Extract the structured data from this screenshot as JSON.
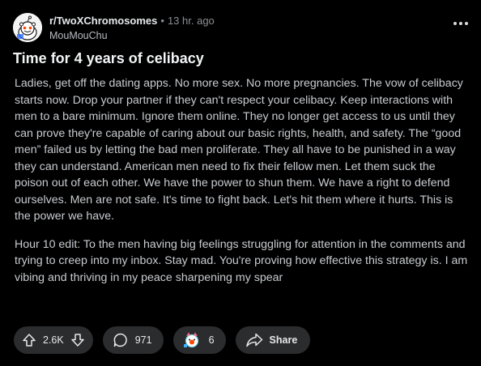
{
  "post": {
    "subreddit": "r/TwoXChromosomes",
    "separator": "•",
    "time": "13 hr. ago",
    "author": "MouMouChu",
    "title": "Time for 4 years of celibacy",
    "paragraphs": [
      "Ladies, get off the dating apps. No more sex. No more pregnancies. The vow of celibacy starts now. Drop your partner if they can't respect your celibacy. Keep interactions with men to a bare minimum. Ignore them online. They no longer get access to us until they can prove they're capable of caring about our basic rights, health, and safety. The “good men” failed us by letting the bad men proliferate. They all have to be punished in a way they can understand. American men need to fix their fellow men. Let them suck the poison out of each other. We have the power to shun them. We have a right to defend ourselves. Men are not safe. It's time to fight back. Let's hit them where it hurts. This is the power we have.",
      "Hour 10 edit: To the men having big feelings struggling for attention in the comments and trying to creep into my inbox. Stay mad. You're proving how effective this strategy is. I am vibing and thriving in my peace sharpening my spear"
    ]
  },
  "actions": {
    "votes": "2.6K",
    "comments": "971",
    "awards": "6",
    "share_label": "Share"
  },
  "icons": {
    "avatar": "reddit-snoo-avatar",
    "more": "more-options-icon",
    "upvote": "upvote-arrow-icon",
    "downvote": "downvote-arrow-icon",
    "comment": "comment-bubble-icon",
    "award": "award-icon",
    "share": "share-arrow-icon"
  },
  "colors": {
    "background": "#000000",
    "pill": "#2a2c2e",
    "text": "#d7dadc"
  }
}
